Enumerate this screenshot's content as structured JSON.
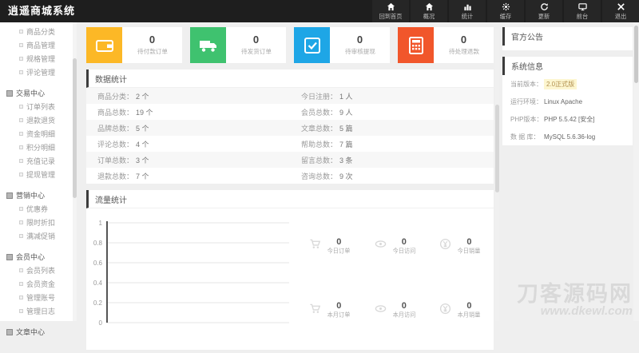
{
  "header": {
    "logo": "逍遥商城系统",
    "nav": [
      {
        "label": "回到首页",
        "icon": "home-icon"
      },
      {
        "label": "概况",
        "icon": "home-icon"
      },
      {
        "label": "统计",
        "icon": "bar-chart-icon"
      },
      {
        "label": "缓存",
        "icon": "gear-icon"
      },
      {
        "label": "更新",
        "icon": "refresh-icon"
      },
      {
        "label": "前台",
        "icon": "monitor-icon"
      },
      {
        "label": "退出",
        "icon": "close-icon"
      }
    ]
  },
  "sidebar": {
    "orphan_items": [
      "商品分类",
      "商品管理",
      "规格管理",
      "评论管理"
    ],
    "sections": [
      {
        "title": "交易中心",
        "items": [
          "订单列表",
          "退款退货",
          "资金明细",
          "积分明细",
          "充值记录",
          "提现管理"
        ]
      },
      {
        "title": "营销中心",
        "items": [
          "优惠券",
          "限时折扣",
          "满减促销"
        ]
      },
      {
        "title": "会员中心",
        "items": [
          "会员列表",
          "会员资金",
          "管理账号",
          "管理日志"
        ]
      },
      {
        "title": "文章中心",
        "items": []
      }
    ]
  },
  "cards": [
    {
      "value": "0",
      "label": "待付款订单",
      "color": "#fcb826",
      "icon": "wallet-icon"
    },
    {
      "value": "0",
      "label": "待发货订单",
      "color": "#3fc26f",
      "icon": "truck-icon"
    },
    {
      "value": "0",
      "label": "待审核提现",
      "color": "#1ea6e6",
      "icon": "check-square-icon"
    },
    {
      "value": "0",
      "label": "待处理退款",
      "color": "#f1562b",
      "icon": "calculator-icon"
    }
  ],
  "stats": {
    "title": "数据统计",
    "rows": [
      {
        "left": {
          "label": "商品分类",
          "value": "2 个"
        },
        "right": {
          "label": "今日注册",
          "value": "1 人"
        }
      },
      {
        "left": {
          "label": "商品总数",
          "value": "19 个"
        },
        "right": {
          "label": "会员总数",
          "value": "9 人"
        }
      },
      {
        "left": {
          "label": "品牌总数",
          "value": "5 个"
        },
        "right": {
          "label": "文章总数",
          "value": "5 篇"
        }
      },
      {
        "left": {
          "label": "评论总数",
          "value": "4 个"
        },
        "right": {
          "label": "帮助总数",
          "value": "7 篇"
        }
      },
      {
        "left": {
          "label": "订单总数",
          "value": "3 个"
        },
        "right": {
          "label": "留言总数",
          "value": "3 条"
        }
      },
      {
        "left": {
          "label": "退款总数",
          "value": "7 个"
        },
        "right": {
          "label": "咨询总数",
          "value": "9 次"
        }
      }
    ]
  },
  "traffic": {
    "title": "流量统计",
    "mini_stats": [
      {
        "value": "0",
        "label": "今日订单",
        "icon": "cart-icon"
      },
      {
        "value": "0",
        "label": "今日访问",
        "icon": "eye-icon"
      },
      {
        "value": "0",
        "label": "今日销量",
        "icon": "coin-icon"
      },
      {
        "value": "0",
        "label": "本月订单",
        "icon": "cart-icon"
      },
      {
        "value": "0",
        "label": "本月访问",
        "icon": "eye-icon"
      },
      {
        "value": "0",
        "label": "本月销量",
        "icon": "coin-icon"
      }
    ]
  },
  "announcement": {
    "title": "官方公告"
  },
  "sysinfo": {
    "title": "系统信息",
    "rows": [
      {
        "label": "当前版本：",
        "value": "2.0正式版"
      },
      {
        "label": "运行环境：",
        "value": "Linux Apache"
      },
      {
        "label": "PHP版本：",
        "value": "PHP 5.5.42 [安全]"
      },
      {
        "label": "数 据 库：",
        "value": "MySQL 5.6.36-log"
      }
    ]
  },
  "watermark": {
    "line1": "刀客源码网",
    "line2": "www.dkewl.com"
  },
  "colors": {
    "header_bg": "#1e1e1e",
    "card_yellow": "#fcb826",
    "card_green": "#3fc26f",
    "card_blue": "#1ea6e6",
    "card_orange": "#f1562b",
    "version_highlight": "#fdf6d0"
  },
  "chart_data": {
    "type": "line",
    "title": "流量统计",
    "x": [],
    "series": [],
    "ylim": [
      0,
      1
    ],
    "yticks": [
      0,
      0.2,
      0.4,
      0.6,
      0.8,
      1
    ],
    "ytick_labels": [
      "1",
      "0.8",
      "0.6",
      "0.4",
      "0.2",
      "0"
    ],
    "grid": true,
    "legend": false
  }
}
